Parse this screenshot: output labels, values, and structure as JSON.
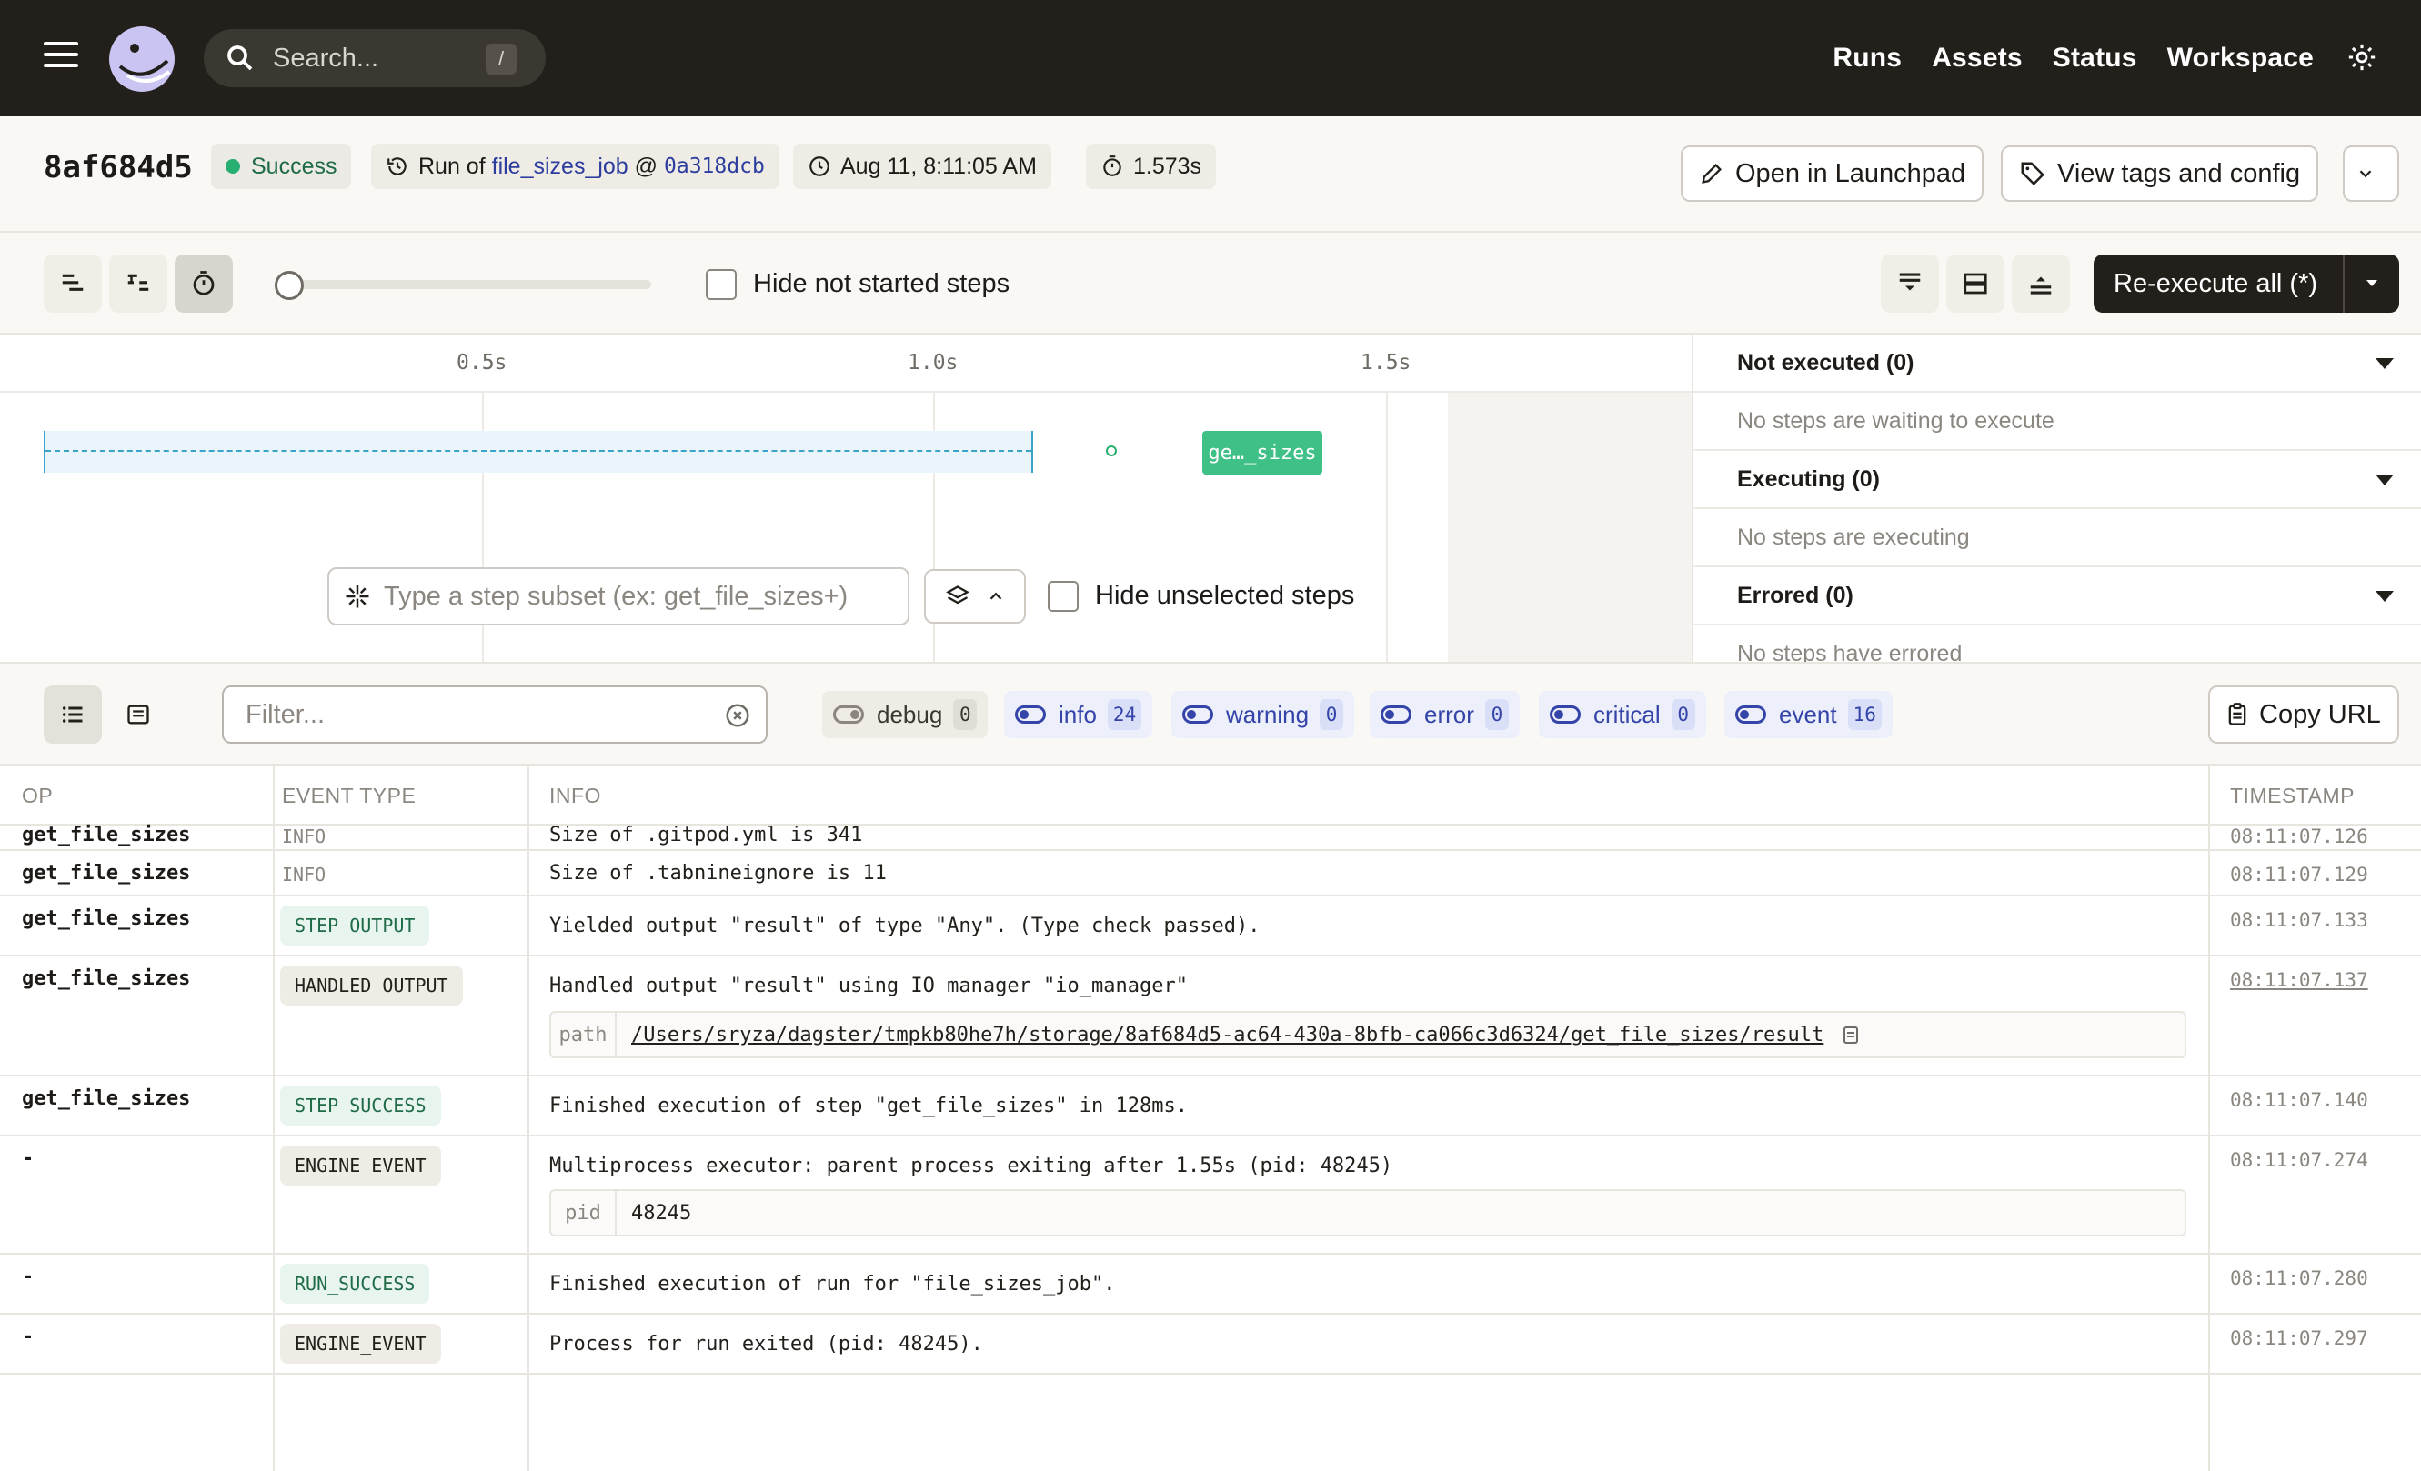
{
  "nav": {
    "search_placeholder": "Search...",
    "search_shortcut": "/",
    "links": [
      "Runs",
      "Assets",
      "Status",
      "Workspace"
    ]
  },
  "run": {
    "id": "8af684d5",
    "status": "Success",
    "run_of_prefix": "Run of",
    "job": "file_sizes_job",
    "at": "@",
    "commit": "0a318dcb",
    "time": "Aug 11, 8:11:05 AM",
    "duration": "1.573s",
    "open_launchpad": "Open in Launchpad",
    "view_tags": "View tags and config"
  },
  "toolbar": {
    "hide_not_started": "Hide not started steps",
    "reexecute": "Re-execute all (*)"
  },
  "gantt": {
    "ticks": [
      "0.5s",
      "1.0s",
      "1.5s"
    ],
    "step_label": "ge…_sizes",
    "subset_placeholder": "Type a step subset (ex: get_file_sizes+)",
    "hide_unselected": "Hide unselected steps"
  },
  "steps_panel": [
    {
      "title": "Not executed (0)",
      "empty": "No steps are waiting to execute"
    },
    {
      "title": "Executing (0)",
      "empty": "No steps are executing"
    },
    {
      "title": "Errored (0)",
      "empty": "No steps have errored"
    }
  ],
  "logs": {
    "filter_placeholder": "Filter...",
    "levels": [
      {
        "name": "debug",
        "count": "0",
        "enabled": false
      },
      {
        "name": "info",
        "count": "24",
        "enabled": true
      },
      {
        "name": "warning",
        "count": "0",
        "enabled": true
      },
      {
        "name": "error",
        "count": "0",
        "enabled": true
      },
      {
        "name": "critical",
        "count": "0",
        "enabled": true
      },
      {
        "name": "event",
        "count": "16",
        "enabled": true
      }
    ],
    "copy_url": "Copy URL",
    "columns": [
      "OP",
      "EVENT TYPE",
      "INFO",
      "TIMESTAMP"
    ],
    "rows": [
      {
        "op": "get_file_sizes",
        "type": "INFO",
        "info": "Size of .gitpod.yml is 341",
        "ts": "08:11:07.126"
      },
      {
        "op": "get_file_sizes",
        "type": "INFO",
        "info": "Size of .tabnineignore is 11",
        "ts": "08:11:07.129"
      },
      {
        "op": "get_file_sizes",
        "type": "STEP_OUTPUT",
        "info": "Yielded output \"result\" of type \"Any\". (Type check passed).",
        "ts": "08:11:07.133"
      },
      {
        "op": "get_file_sizes",
        "type": "HANDLED_OUTPUT",
        "info": "Handled output \"result\" using IO manager \"io_manager\"",
        "meta_key": "path",
        "meta_val": "/Users/sryza/dagster/tmpkb80he7h/storage/8af684d5-ac64-430a-8bfb-ca066c3d6324/get_file_sizes/result",
        "ts": "08:11:07.137"
      },
      {
        "op": "get_file_sizes",
        "type": "STEP_SUCCESS",
        "info": "Finished execution of step \"get_file_sizes\" in 128ms.",
        "ts": "08:11:07.140"
      },
      {
        "op": "-",
        "type": "ENGINE_EVENT",
        "info": "Multiprocess executor: parent process exiting after 1.55s (pid: 48245)",
        "meta_key": "pid",
        "meta_val": "48245",
        "ts": "08:11:07.274"
      },
      {
        "op": "-",
        "type": "RUN_SUCCESS",
        "info": "Finished execution of run for \"file_sizes_job\".",
        "ts": "08:11:07.280"
      },
      {
        "op": "-",
        "type": "ENGINE_EVENT",
        "info": "Process for run exited (pid: 48245).",
        "ts": "08:11:07.297"
      }
    ]
  }
}
